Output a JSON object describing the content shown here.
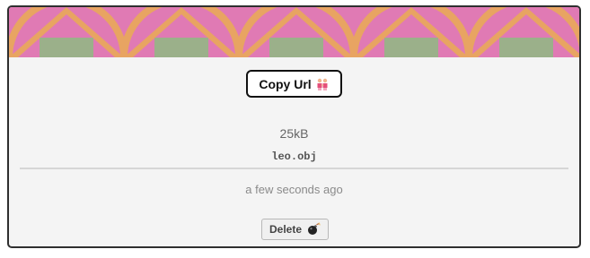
{
  "banner": {
    "colors": {
      "background": "#e07ab4",
      "shape": "#e8a462",
      "block": "#9bb08a"
    }
  },
  "actions": {
    "copy_url_label": "Copy Url",
    "copy_url_icon": "people-holding-hands-icon",
    "delete_label": "Delete",
    "delete_icon": "bomb-icon"
  },
  "file": {
    "size": "25kB",
    "name": "leo.obj",
    "uploaded": "a few seconds ago"
  }
}
